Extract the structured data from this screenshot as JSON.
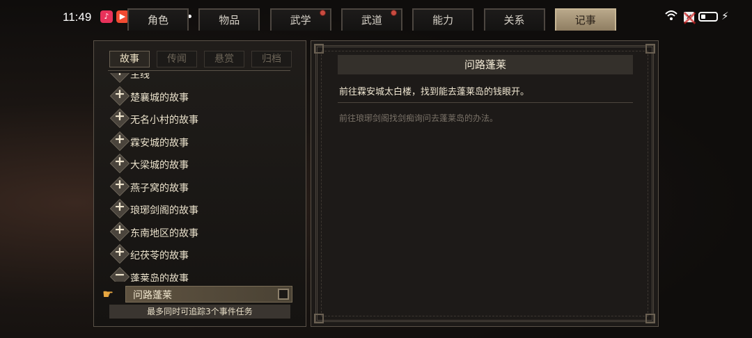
{
  "status": {
    "time": "11:49",
    "icons": [
      {
        "name": "music-app-icon",
        "color": "#e8325a",
        "glyph": "♪"
      },
      {
        "name": "video-app-icon",
        "color": "#f24b32",
        "glyph": "▶"
      },
      {
        "name": "blue-app-icon",
        "color": "#2e86f0",
        "glyph": "◉"
      },
      {
        "name": "green-app-icon",
        "color": "#2fa35a",
        "glyph": "∞"
      },
      {
        "name": "red-app-icon",
        "color": "#d93a2a",
        "glyph": "❀"
      }
    ],
    "wifi_glyph": "((·))",
    "charging_glyph": "⚡",
    "muted_x": "✕"
  },
  "tabs": {
    "items": [
      {
        "label": "角色",
        "badge": false,
        "active": false
      },
      {
        "label": "物品",
        "badge": false,
        "active": false
      },
      {
        "label": "武学",
        "badge": true,
        "active": false
      },
      {
        "label": "武道",
        "badge": true,
        "active": false
      },
      {
        "label": "能力",
        "badge": false,
        "active": false
      },
      {
        "label": "关系",
        "badge": false,
        "active": false
      },
      {
        "label": "记事",
        "badge": false,
        "active": true
      }
    ]
  },
  "left": {
    "subtabs": [
      {
        "label": "故事",
        "active": true
      },
      {
        "label": "传闻",
        "active": false
      },
      {
        "label": "悬赏",
        "active": false
      },
      {
        "label": "归档",
        "active": false
      }
    ],
    "items": [
      {
        "label": "主线",
        "sign": "+"
      },
      {
        "label": "楚襄城的故事",
        "sign": "+"
      },
      {
        "label": "无名小村的故事",
        "sign": "+"
      },
      {
        "label": "霖安城的故事",
        "sign": "+"
      },
      {
        "label": "大梁城的故事",
        "sign": "+"
      },
      {
        "label": "燕子窝的故事",
        "sign": "+"
      },
      {
        "label": "琅琊剑阁的故事",
        "sign": "+"
      },
      {
        "label": "东南地区的故事",
        "sign": "+"
      },
      {
        "label": "纪茯苓的故事",
        "sign": "+"
      },
      {
        "label": "蓬莱岛的故事",
        "sign": "−"
      }
    ],
    "selected": {
      "label": "问路蓬莱",
      "pointer_glyph": "☛"
    },
    "footer": "最多同时可追踪3个事件任务"
  },
  "right": {
    "title": "问路蓬莱",
    "description": "前往霖安城太白楼，找到能去蓬莱岛的钱眼开。",
    "hint": "前往琅琊剑阁找剑痴询问去蓬莱岛的办法。"
  }
}
